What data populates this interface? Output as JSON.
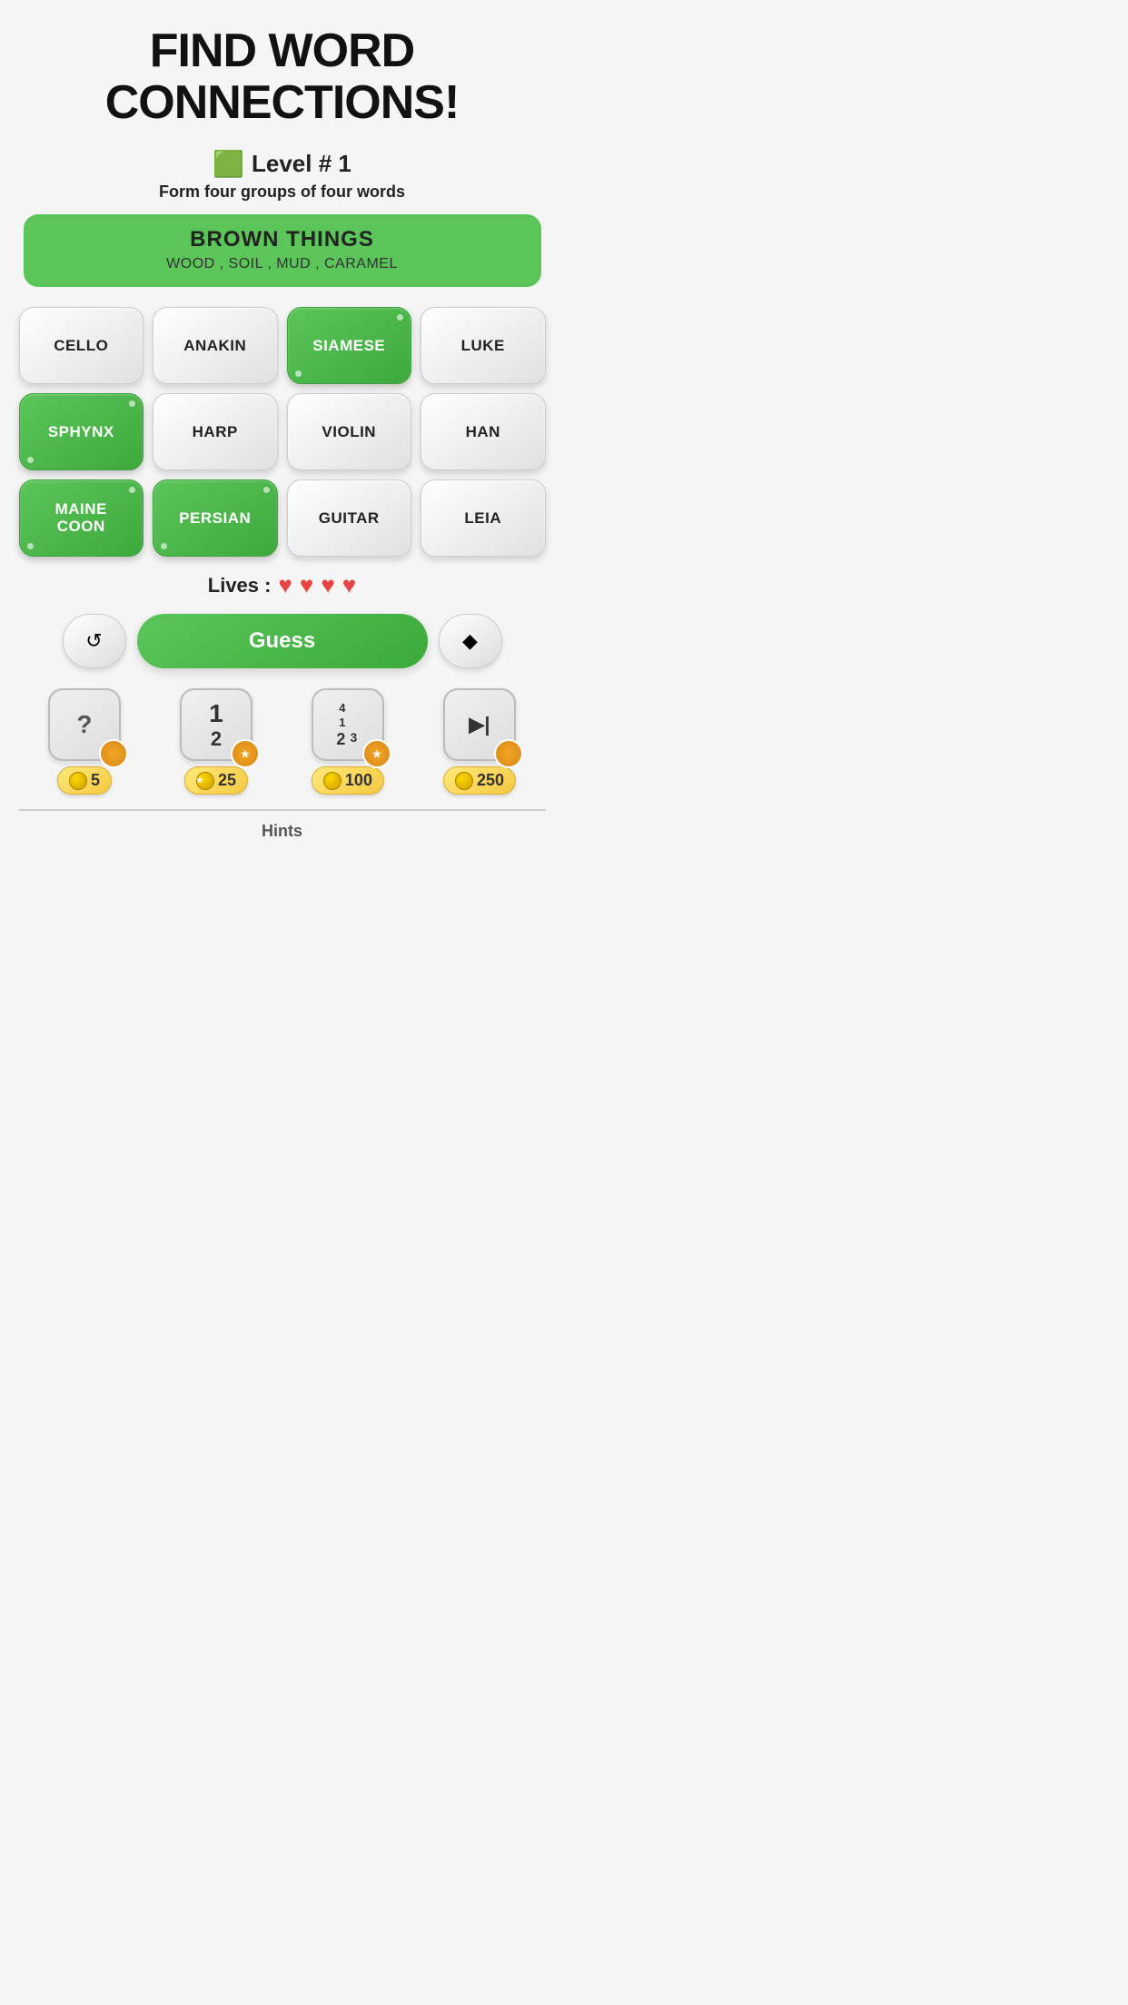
{
  "title_line1": "FIND WORD",
  "title_line2": "CONNECTIONS!",
  "level": {
    "icon": "🟩",
    "text": "Level # 1"
  },
  "subtitle": "Form four groups of four words",
  "banner": {
    "title": "BROWN THINGS",
    "words": "WOOD , SOIL , MUD , CARAMEL"
  },
  "tiles": [
    {
      "label": "CELLO",
      "state": "white"
    },
    {
      "label": "ANAKIN",
      "state": "white"
    },
    {
      "label": "SIAMESE",
      "state": "green"
    },
    {
      "label": "LUKE",
      "state": "white"
    },
    {
      "label": "SPHYNX",
      "state": "green"
    },
    {
      "label": "HARP",
      "state": "white"
    },
    {
      "label": "VIOLIN",
      "state": "white"
    },
    {
      "label": "HAN",
      "state": "white"
    },
    {
      "label": "MAINE COON",
      "state": "green",
      "multiline": true
    },
    {
      "label": "PERSIAN",
      "state": "green"
    },
    {
      "label": "GUITAR",
      "state": "white"
    },
    {
      "label": "LEIA",
      "state": "white"
    }
  ],
  "lives": {
    "label": "Lives :",
    "count": 4
  },
  "buttons": {
    "refresh_label": "↺",
    "guess_label": "Guess",
    "erase_label": "◆"
  },
  "hints": [
    {
      "type": "question",
      "label": "?",
      "badge": "orange",
      "cost": "5"
    },
    {
      "type": "numbers12",
      "label1": "1",
      "label2": "2",
      "badge": "orange-star",
      "cost": "25"
    },
    {
      "type": "numbers123",
      "label1": "4",
      "label2": "1",
      "label3": "2",
      "label4": "3",
      "badge": "orange-star",
      "cost": "100"
    },
    {
      "type": "play",
      "label": "▶|",
      "badge": "orange",
      "cost": "250"
    }
  ],
  "hints_label": "Hints"
}
